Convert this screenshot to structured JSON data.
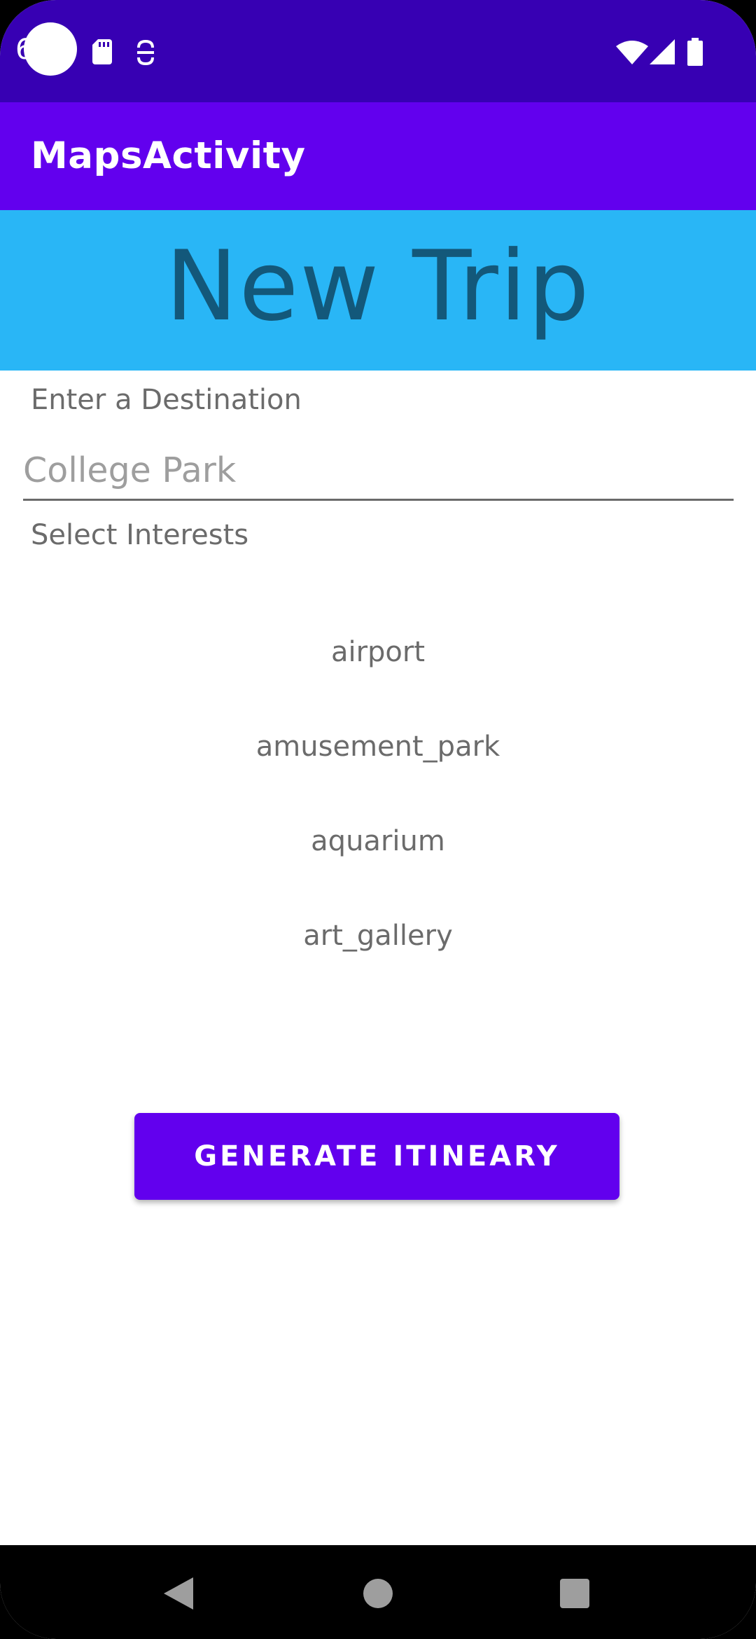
{
  "status_bar": {
    "time_fragment": "6",
    "icons": [
      "sd-card-icon",
      "sync-badge-icon",
      "wifi-icon",
      "cell-signal-icon",
      "battery-icon"
    ]
  },
  "app_bar": {
    "title": "MapsActivity"
  },
  "header": {
    "title": "New Trip"
  },
  "destination": {
    "label": "Enter a Destination",
    "placeholder": "College Park",
    "value": ""
  },
  "interests": {
    "label": "Select Interests",
    "items": [
      "airport",
      "amusement_park",
      "aquarium",
      "art_gallery"
    ]
  },
  "generate_button": {
    "label": "GENERATE ITINEARY"
  },
  "nav_bar": {
    "icons": [
      "back-icon",
      "home-icon",
      "recents-icon"
    ]
  },
  "colors": {
    "status_bar": "#3700b3",
    "app_bar": "#6200ee",
    "banner": "#29b6f6",
    "banner_text": "#13587a",
    "button": "#6200ee"
  }
}
